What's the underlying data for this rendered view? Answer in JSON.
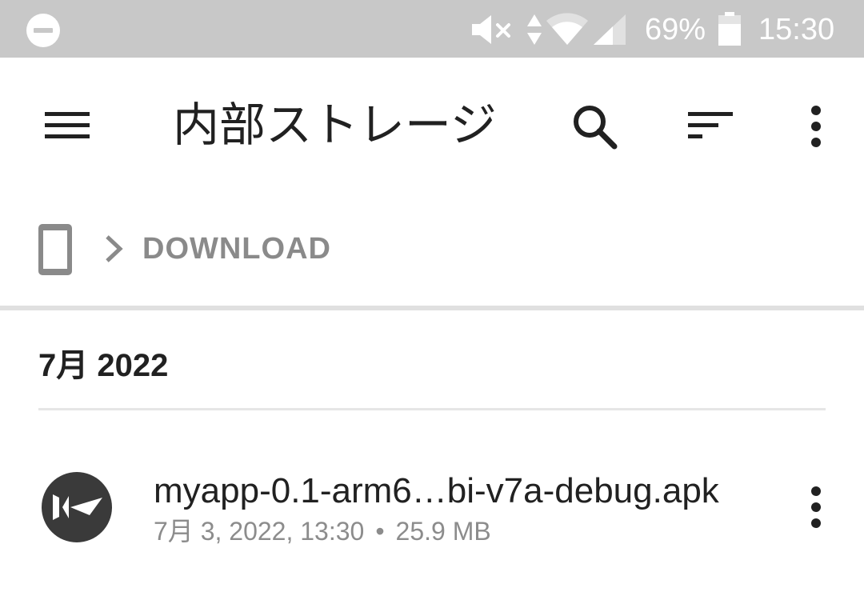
{
  "status_bar": {
    "battery_percent": "69%",
    "time": "15:30",
    "icons": [
      "do-not-disturb-icon",
      "mute-icon",
      "data-arrows-icon",
      "wifi-icon",
      "cell-signal-icon",
      "battery-icon"
    ],
    "text_color": "#ffffff",
    "background": "#c8c8c8"
  },
  "toolbar": {
    "title": "内部ストレージ",
    "icons": [
      "menu-icon",
      "search-icon",
      "sort-icon",
      "more-vert-icon"
    ]
  },
  "breadcrumb": {
    "root_icon": "phone-device-icon",
    "separator_icon": "chevron-right-icon",
    "current": "DOWNLOAD"
  },
  "section": {
    "header": "7月 2022"
  },
  "files": [
    {
      "icon": "kivy-app-icon",
      "name": "myapp-0.1-arm6…bi-v7a-debug.apk",
      "date": "7月 3, 2022, 13:30",
      "separator": "•",
      "size": "25.9 MB"
    }
  ],
  "colors": {
    "primary_text": "#212121",
    "secondary_text": "#8c8c8c",
    "divider": "#e0e0e0",
    "icon_dark": "#3a3a3a"
  }
}
